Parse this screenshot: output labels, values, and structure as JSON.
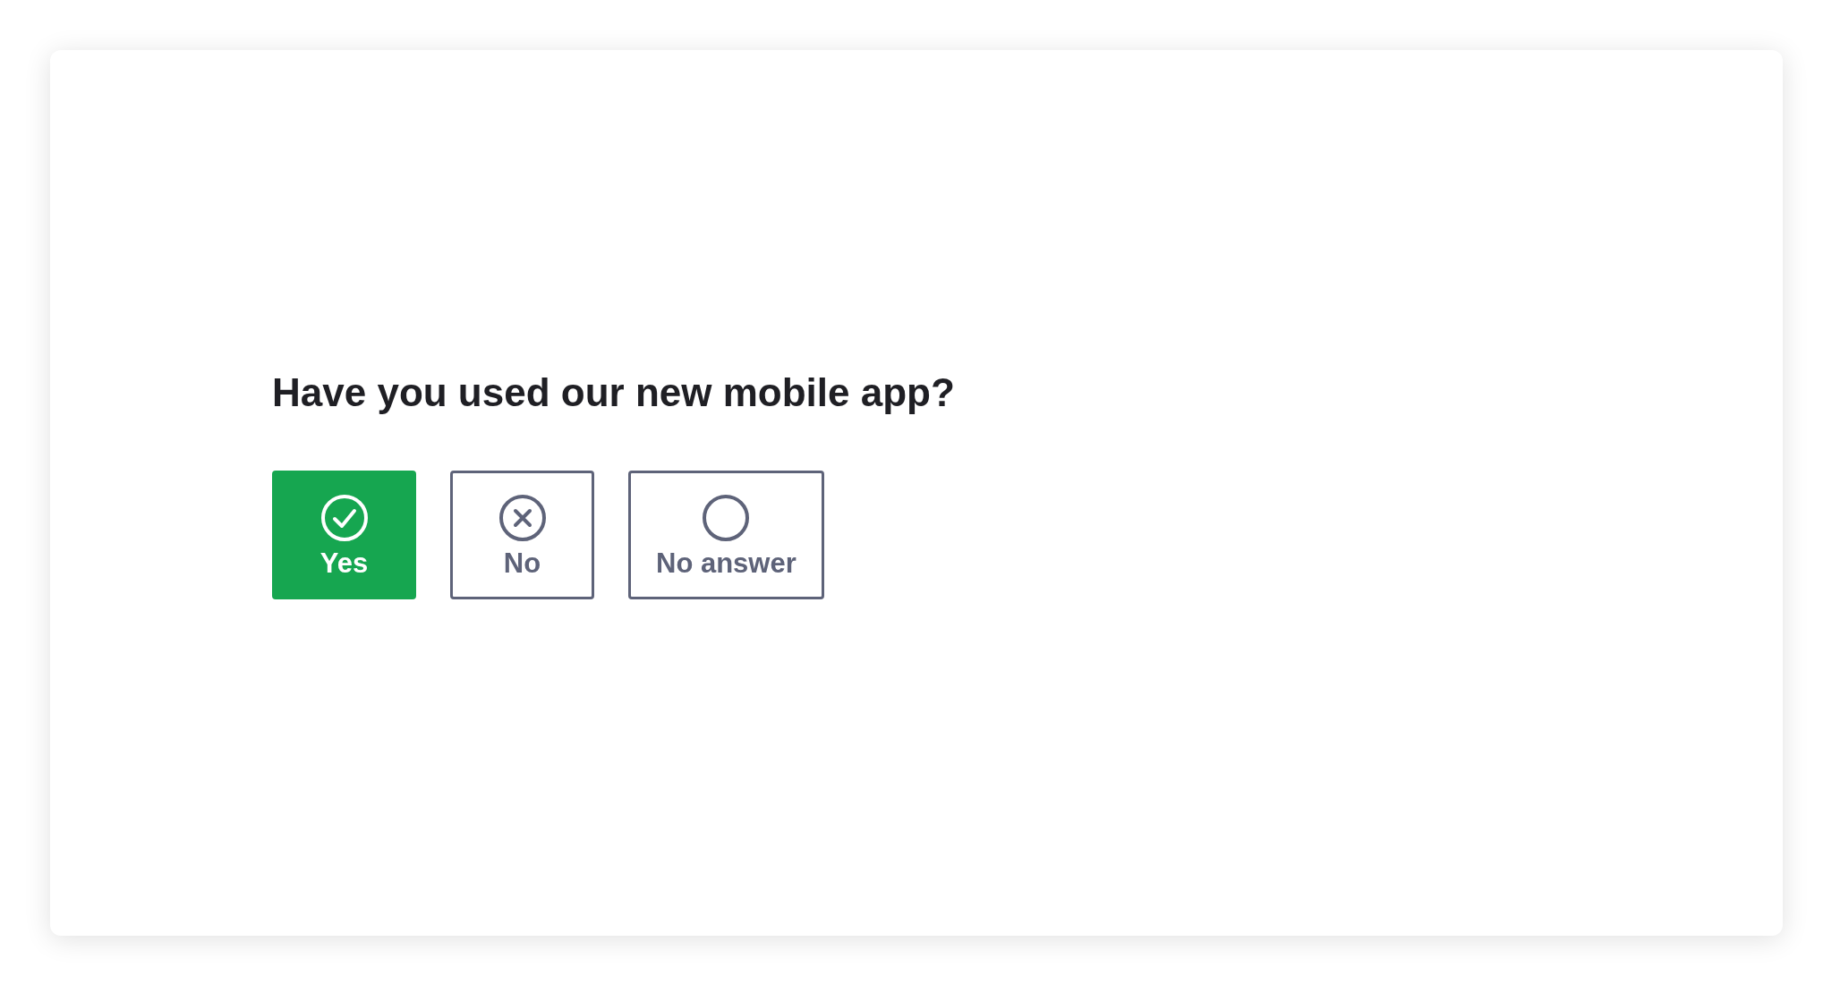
{
  "question": "Have you used our new mobile app?",
  "options": [
    {
      "label": "Yes",
      "kind": "check",
      "selected": true
    },
    {
      "label": "No",
      "kind": "cross",
      "selected": false
    },
    {
      "label": "No answer",
      "kind": "empty",
      "selected": false
    }
  ]
}
